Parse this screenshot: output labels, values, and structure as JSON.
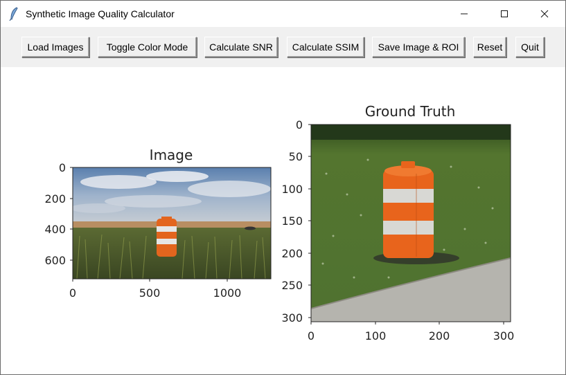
{
  "window": {
    "title": "Synthetic Image Quality Calculator",
    "icon": "feather-icon"
  },
  "toolbar": {
    "buttons": [
      {
        "label": "Load Images"
      },
      {
        "label": "Toggle Color Mode"
      },
      {
        "label": "Calculate SNR"
      },
      {
        "label": "Calculate SSIM"
      },
      {
        "label": "Save Image & ROI"
      },
      {
        "label": "Reset"
      },
      {
        "label": "Quit"
      }
    ]
  },
  "plots": {
    "image": {
      "title": "Image",
      "xticks": [
        "0",
        "500",
        "1000"
      ],
      "yticks": [
        "0",
        "200",
        "400",
        "600"
      ]
    },
    "ground_truth": {
      "title": "Ground Truth",
      "xticks": [
        "0",
        "100",
        "200",
        "300"
      ],
      "yticks": [
        "0",
        "50",
        "100",
        "150",
        "200",
        "250",
        "300"
      ]
    }
  },
  "chart_data": [
    {
      "type": "image",
      "title": "Image",
      "xlim": [
        0,
        1290
      ],
      "ylim": [
        720,
        0
      ],
      "xticks": [
        0,
        500,
        1000
      ],
      "yticks": [
        0,
        200,
        400,
        600
      ]
    },
    {
      "type": "image",
      "title": "Ground Truth",
      "xlim": [
        0,
        310
      ],
      "ylim": [
        310,
        0
      ],
      "xticks": [
        0,
        100,
        200,
        300
      ],
      "yticks": [
        0,
        50,
        100,
        150,
        200,
        250,
        300
      ]
    }
  ]
}
